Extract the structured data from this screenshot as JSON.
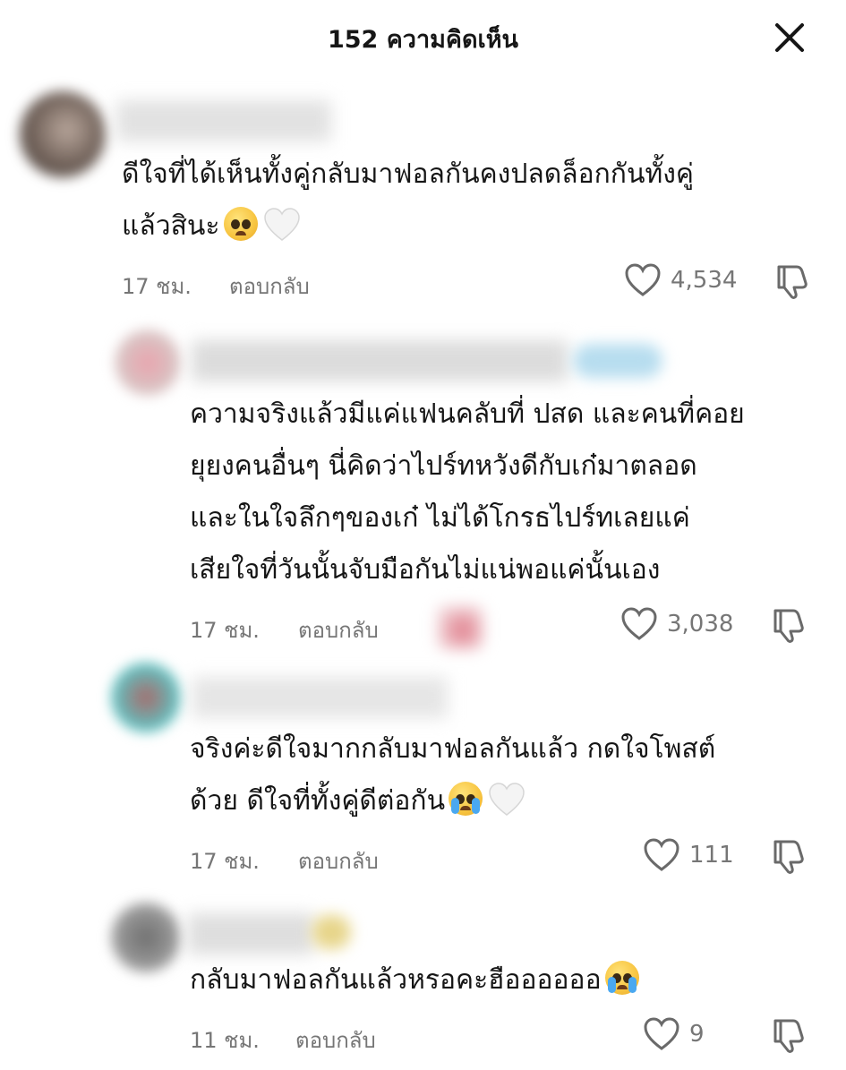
{
  "header": {
    "title": "152 ความคิดเห็น",
    "close_icon": "close-icon"
  },
  "comments": [
    {
      "text_lines": [
        "ดีใจที่ได้เห็นทั้งคู่กลับมาฟอลกันคงปลดล็อกกันทั้งคู่",
        "แล้วสินะ"
      ],
      "emojis": [
        "pleading-face-emoji",
        "white-heart-emoji"
      ],
      "time": "17 ชม.",
      "reply": "ตอบกลับ",
      "likes": "4,534"
    },
    {
      "text_lines": [
        "ความจริงแล้วมีแค่แฟนคลับที่ ปสด และคนที่คอย",
        "ยุยงคนอื่นๆ นี่คิดว่าไปร์ทหวังดีกับเก๋มาตลอด",
        "และในใจลึกๆของเก๋ ไม่ได้โกรธไปร์ทเลยแค่",
        "เสียใจที่วันนั้นจับมือกันไม่แน่พอแค่นั้นเอง"
      ],
      "time": "17 ชม.",
      "reply": "ตอบกลับ",
      "likes": "3,038"
    },
    {
      "text_lines": [
        "จริงค่ะดีใจมากกลับมาฟอลกันแล้ว กดใจโพสต์",
        "ด้วย ดีใจที่ทั้งคู่ดีต่อกัน"
      ],
      "emojis": [
        "loudly-crying-face-emoji",
        "white-heart-emoji"
      ],
      "time": "17 ชม.",
      "reply": "ตอบกลับ",
      "likes": "111"
    },
    {
      "text_lines": [
        "กลับมาฟอลกันแล้วหรอคะฮืออออออ"
      ],
      "emojis": [
        "loudly-crying-face-emoji"
      ],
      "time": "11 ชม.",
      "reply": "ตอบกลับ",
      "likes": "9"
    }
  ],
  "colors": {
    "text": "#161616",
    "secondary": "#767676",
    "background": "#ffffff"
  },
  "icons": {
    "like": "heart-outline-icon",
    "dislike": "thumbs-down-icon"
  }
}
